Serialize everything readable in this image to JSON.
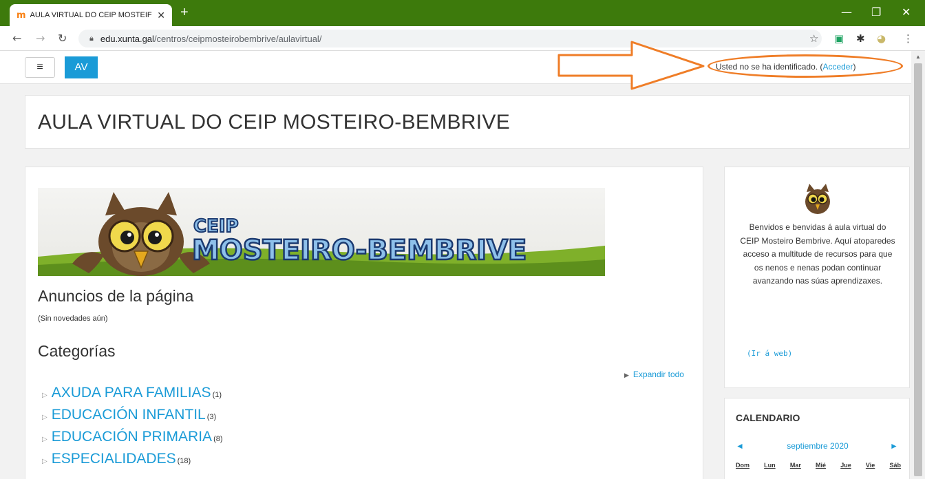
{
  "browser": {
    "tab_favicon": "m",
    "tab_title": "AULA VIRTUAL DO CEIP MOSTEIF",
    "tab_close": "✕",
    "new_tab": "+",
    "url_host": "edu.xunta.gal",
    "url_path": "/centros/ceipmosteirobembrive/aulavirtual/",
    "window_controls": [
      "—",
      "❐",
      "✕"
    ]
  },
  "header": {
    "menu_icon": "≡",
    "brand": "AV",
    "login_text": "Usted no se ha identificado. (",
    "login_link": "Acceder",
    "login_close": ")"
  },
  "page": {
    "title": "AULA VIRTUAL DO CEIP MOSTEIRO-BEMBRIVE"
  },
  "banner": {
    "line1": "CEIP",
    "line2": "MOSTEIRO-BEMBRIVE"
  },
  "announcements": {
    "title": "Anuncios de la página",
    "note": "(Sin novedades aún)"
  },
  "categories": {
    "title": "Categorías",
    "expand_all": "Expandir todo",
    "items": [
      {
        "name": "AXUDA PARA FAMILIAS",
        "count": "(1)"
      },
      {
        "name": "EDUCACIÓN INFANTIL",
        "count": "(3)"
      },
      {
        "name": "EDUCACIÓN PRIMARIA",
        "count": "(8)"
      },
      {
        "name": "ESPECIALIDADES",
        "count": "(18)"
      }
    ]
  },
  "sidebar": {
    "welcome_text": "Benvidos e benvidas á aula virtual do CEIP Mosteiro Bembrive. Aquí atoparedes acceso a multitude de recursos para que os nenos e nenas podan continuar avanzando nas súas aprendizaxes.",
    "web_link": "(Ir á web)"
  },
  "calendar": {
    "title": "CALENDARIO",
    "month": "septiembre 2020",
    "prev": "◄",
    "next": "►",
    "days": [
      "Dom",
      "Lun",
      "Mar",
      "Mié",
      "Jue",
      "Vie",
      "Sáb"
    ]
  },
  "colors": {
    "tabbar": "#3d7a0c",
    "accent": "#1a9bd7",
    "annotation": "#ef7d27"
  }
}
